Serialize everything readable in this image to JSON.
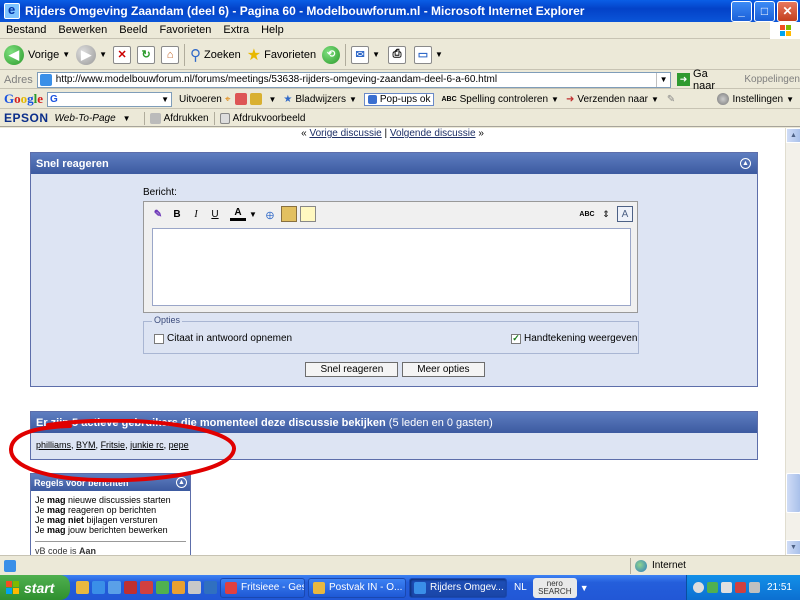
{
  "window": {
    "title": "Rijders Omgeving Zaandam (deel 6) - Pagina 60 - Modelbouwforum.nl - Microsoft Internet Explorer",
    "minimize": "_",
    "maximize": "□",
    "close": "✕"
  },
  "menu": [
    "Bestand",
    "Bewerken",
    "Beeld",
    "Favorieten",
    "Extra",
    "Help"
  ],
  "toolbar": {
    "back": "Vorige",
    "search": "Zoeken",
    "favorites": "Favorieten"
  },
  "address": {
    "label": "Adres",
    "url": "http://www.modelbouwforum.nl/forums/meetings/53638-rijders-omgeving-zaandam-deel-6-a-60.html",
    "go": "Ga naar",
    "links": "Koppelingen"
  },
  "google_bar": {
    "logo": [
      "G",
      "o",
      "o",
      "g",
      "l",
      "e"
    ],
    "search_prefix": "G",
    "run": "Uitvoeren",
    "bookmarks": "Bladwijzers",
    "popups": "Pop-ups ok",
    "spell_icon": "ABC",
    "spell": "Spelling controleren",
    "send": "Verzenden naar",
    "settings": "Instellingen"
  },
  "epson_bar": {
    "brand": "EPSON",
    "web_to_page": "Web-To-Page",
    "print": "Afdrukken",
    "preview": "Afdrukvoorbeeld"
  },
  "nav": {
    "prev_mark": "«",
    "prev": "Vorige discussie",
    "separator": "|",
    "next": "Volgende discussie",
    "next_mark": "»"
  },
  "quick_reply": {
    "title": "Snel reageren",
    "message_label": "Bericht:",
    "tools": [
      "B",
      "I",
      "U",
      "A"
    ],
    "spell_tool": "ABC",
    "options_legend": "Opties",
    "quote_option": "Citaat in antwoord opnemen",
    "signature_option": "Handtekening weergeven",
    "signature_checked": true,
    "submit": "Snel reageren",
    "more": "Meer opties"
  },
  "active_users": {
    "title": "Er zijn 5 actieve gebruikers die momenteel deze discussie bekijken",
    "count": "(5 leden en 0 gasten)",
    "users": [
      "philliams",
      "BYM",
      "Fritsie",
      "junkie rc",
      "pepe"
    ]
  },
  "posting_rules": {
    "title": "Regels voor berichten",
    "lines": [
      {
        "a": "Je ",
        "b": "mag",
        "c": " nieuwe discussies starten"
      },
      {
        "a": "Je ",
        "b": "mag",
        "c": " reageren op berichten"
      },
      {
        "a": "Je ",
        "b": "mag niet",
        "c": " bijlagen versturen"
      },
      {
        "a": "Je ",
        "b": "mag",
        "c": " jouw berichten bewerken"
      }
    ],
    "vbcode_prefix": "vB code is ",
    "vbcode_state": "Aan"
  },
  "status": {
    "zone": "Internet"
  },
  "taskbar": {
    "start": "start",
    "tasks": [
      "Fritsieee - Ges...",
      "Postvak IN - O...",
      "Rijders Omgev..."
    ],
    "language": "NL",
    "nero_top": "nero",
    "nero_bottom": "SEARCH",
    "clock": "21:51"
  },
  "colors": {
    "panel_header": "#3c5aa0",
    "annotation": "#e00000",
    "titlebar": "#0342c8"
  }
}
